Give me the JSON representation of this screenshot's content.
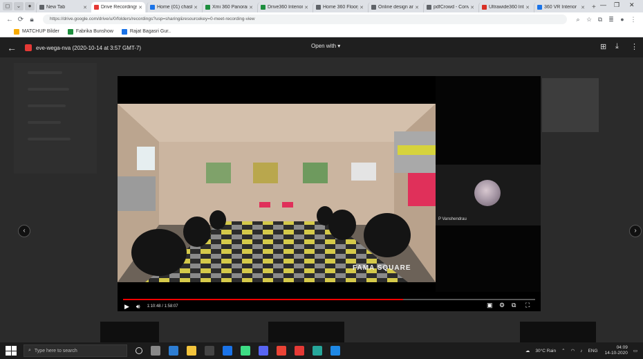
{
  "browser": {
    "tabs": [
      {
        "title": "New Tab",
        "active": false,
        "color": "#5f6368"
      },
      {
        "title": "Drive Recordings",
        "active": true,
        "color": "#e53935"
      },
      {
        "title": "Home (01) chaster",
        "active": false,
        "color": "#1a73e8"
      },
      {
        "title": "Xmi 360 Panorama",
        "active": false,
        "color": "#1e8e3e"
      },
      {
        "title": "Drive360 Interior",
        "active": false,
        "color": "#1e8e3e"
      },
      {
        "title": "Home 360 Floorplan",
        "active": false,
        "color": "#5f6368"
      },
      {
        "title": "Online design and",
        "active": false,
        "color": "#5f6368"
      },
      {
        "title": "pdfCrowd - Conv",
        "active": false,
        "color": "#5f6368"
      },
      {
        "title": "Ultrawide360 Inte",
        "active": false,
        "color": "#d93025"
      },
      {
        "title": "360 VR Interior",
        "active": false,
        "color": "#1a73e8"
      }
    ],
    "url": "https://drive.google.com/drive/u/0/folders/recordings?usp=sharing&resourcekey=0-meet-recording-view",
    "bookmarks": [
      {
        "label": "MATCHUP Bilder",
        "color": "#f9ab00"
      },
      {
        "label": "Fabrika Bunshow",
        "color": "#1e8e3e"
      },
      {
        "label": "Rajat Bagasri Gur..",
        "color": "#1a73e8"
      }
    ]
  },
  "viewer": {
    "file_name": "eve-wega-nva (2020-10-14 at 3:57 GMT-7)",
    "open_with": "Open with ▾",
    "icons": {
      "back": "back-arrow-icon",
      "add": "add-to-drive-icon",
      "download": "download-icon",
      "more": "more-vert-icon"
    }
  },
  "player": {
    "watermark": "FAMA SQUARE",
    "participant_name": "P Vanshendrau",
    "timecode": "1:10:48 / 1:58:07",
    "progress": 0.68,
    "controls": [
      "play-icon",
      "volume-icon",
      "settings-icon",
      "miniplayer-icon",
      "fullscreen-icon"
    ]
  },
  "taskbar": {
    "search_placeholder": "Type here to search",
    "weather": "30°C Rain",
    "lang": "ENG",
    "time": "04:09",
    "date": "14-10-2020"
  }
}
